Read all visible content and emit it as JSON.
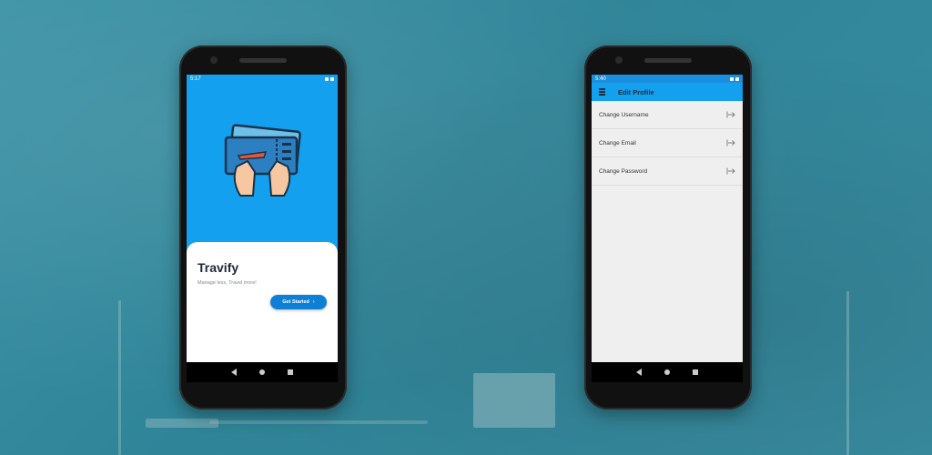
{
  "phone1": {
    "status_time": "5:17",
    "app_name": "Travify",
    "tagline": "Manage less, Travel more!",
    "cta_label": "Get Started",
    "cta_chevron": "›",
    "accent": "#13a1ef",
    "button_color": "#0d7fd6"
  },
  "phone2": {
    "status_time": "5:40",
    "title": "Edit Profile",
    "menu": [
      {
        "label": "Change Username",
        "icon": "exit-icon"
      },
      {
        "label": "Change Email",
        "icon": "exit-icon"
      },
      {
        "label": "Change Password",
        "icon": "exit-icon"
      }
    ]
  }
}
